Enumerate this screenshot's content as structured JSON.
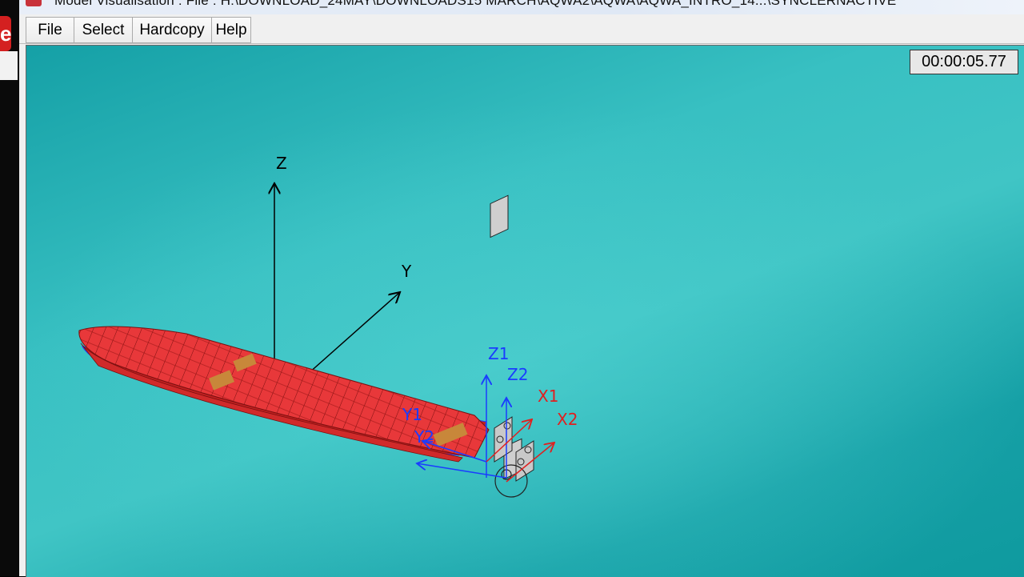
{
  "titlebar": {
    "title": "Model Visualisation : File : H:\\DOWNLOAD_24MAY\\DOWNLOADS15 MARCH\\AQWA2\\AQWA\\AQWA_INTRO_14...\\SYNCLERNACTIVE"
  },
  "menu": {
    "file": "File",
    "select": "Select",
    "hardcopy": "Hardcopy",
    "help": "Help"
  },
  "viewport": {
    "timer": "00:00:05.77",
    "global_axes": {
      "z": "Z",
      "y": "Y"
    },
    "local_axes": {
      "z1": "Z1",
      "z2": "Z2",
      "x1": "X1",
      "x2": "X2",
      "y1": "Y1",
      "y2": "Y2"
    }
  },
  "colors": {
    "background": "#3cc2c4",
    "hull": "#e8383a",
    "hull_lines": "#7a1010",
    "deck_patch": "#c8873a",
    "axis_black": "#000000",
    "axis_blue": "#1a3cff",
    "axis_red": "#e02020"
  }
}
